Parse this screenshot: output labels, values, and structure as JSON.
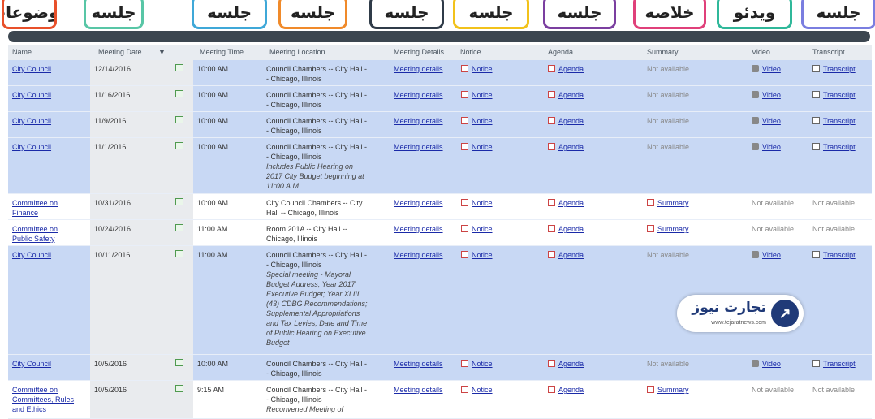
{
  "callouts": [
    {
      "label": "موضوعات",
      "border": "#e8502a",
      "pointer": "#e8502a"
    },
    {
      "label": "جلسه",
      "border": "#58c6a6",
      "pointer": "#58c6a6"
    },
    {
      "label": "جلسه",
      "border": "#3fa8d8",
      "pointer": "#3fa8d8"
    },
    {
      "label": "جلسه",
      "border": "#f08a2a",
      "pointer": "#f08a2a"
    },
    {
      "label": "جلسه",
      "border": "#2f3b48",
      "pointer": "#2f3b48"
    },
    {
      "label": "جلسه",
      "border": "#f2c21b",
      "pointer": "#f2c21b"
    },
    {
      "label": "جلسه",
      "border": "#7b3fa0",
      "pointer": "#7b3fa0"
    },
    {
      "label": "خلاصه",
      "border": "#e0407a",
      "pointer": "#e0407a"
    },
    {
      "label": "ویدئو",
      "border": "#2fb89a",
      "pointer": "#2fb89a"
    },
    {
      "label": "جلسه",
      "border": "#7a7ee0",
      "pointer": "#7a7ee0"
    }
  ],
  "columns": [
    "Name",
    "Meeting Date",
    "Meeting Time",
    "Meeting Location",
    "Meeting Details",
    "Notice",
    "Agenda",
    "Summary",
    "Video",
    "Transcript"
  ],
  "sort_indicator": "▼",
  "rows": [
    {
      "name": "City Council",
      "date": "12/14/2016",
      "time": "10:00 AM",
      "location": "Council Chambers -- City Hall -\n- Chicago, Illinois",
      "note": "",
      "details": "Meeting details",
      "notice": "Notice",
      "agenda": "Agenda",
      "summary": "Not available",
      "video": "Video",
      "transcript": "Transcript"
    },
    {
      "name": "City Council",
      "date": "11/16/2016",
      "time": "10:00 AM",
      "location": "Council Chambers -- City Hall -\n- Chicago, Illinois",
      "note": "",
      "details": "Meeting details",
      "notice": "Notice",
      "agenda": "Agenda",
      "summary": "Not available",
      "video": "Video",
      "transcript": "Transcript"
    },
    {
      "name": "City Council",
      "date": "11/9/2016",
      "time": "10:00 AM",
      "location": "Council Chambers -- City Hall -\n- Chicago, Illinois",
      "note": "",
      "details": "Meeting details",
      "notice": "Notice",
      "agenda": "Agenda",
      "summary": "Not available",
      "video": "Video",
      "transcript": "Transcript"
    },
    {
      "name": "City Council",
      "date": "11/1/2016",
      "time": "10:00 AM",
      "location": "Council Chambers -- City Hall -\n- Chicago, Illinois",
      "note": "Includes Public Hearing on\n2017 City Budget beginning at\n11:00 A.M.",
      "details": "Meeting details",
      "notice": "Notice",
      "agenda": "Agenda",
      "summary": "Not available",
      "video": "Video",
      "transcript": "Transcript"
    },
    {
      "name": "Committee on\nFinance",
      "date": "10/31/2016",
      "time": "10:00 AM",
      "location": "City Council Chambers -- City\nHall -- Chicago, Illinois",
      "note": "",
      "details": "Meeting details",
      "notice": "Notice",
      "agenda": "Agenda",
      "summary": "Summary",
      "video": "Not available",
      "transcript": "Not available"
    },
    {
      "name": "Committee on\nPublic Safety",
      "date": "10/24/2016",
      "time": "11:00 AM",
      "location": "Room 201A -- City Hall --\nChicago, Illinois",
      "note": "",
      "details": "Meeting details",
      "notice": "Notice",
      "agenda": "Agenda",
      "summary": "Summary",
      "video": "Not available",
      "transcript": "Not available"
    },
    {
      "name": "City Council",
      "date": "10/11/2016",
      "time": "11:00 AM",
      "location": "Council Chambers -- City Hall -\n- Chicago, Illinois",
      "note": "Special meeting - Mayoral\nBudget Address; Year 2017\nExecutive Budget; Year XLIII\n(43) CDBG Recommendations;\nSupplemental Appropriations\nand Tax Levies; Date and Time\nof Public Hearing on Executive\nBudget",
      "details": "Meeting details",
      "notice": "Notice",
      "agenda": "Agenda",
      "summary": "Not available",
      "video": "Video",
      "transcript": "Transcript"
    },
    {
      "name": "City Council",
      "date": "10/5/2016",
      "time": "10:00 AM",
      "location": "Council Chambers -- City Hall -\n- Chicago, Illinois",
      "note": "",
      "details": "Meeting details",
      "notice": "Notice",
      "agenda": "Agenda",
      "summary": "Not available",
      "video": "Video",
      "transcript": "Transcript"
    },
    {
      "name": "Committee on\nCommittees, Rules\nand Ethics",
      "date": "10/5/2016",
      "time": "9:15 AM",
      "location": "Council Chambers -- City Hall -\n- Chicago, Illinois",
      "note": "Reconvened Meeting of",
      "details": "Meeting details",
      "notice": "Notice",
      "agenda": "Agenda",
      "summary": "Summary",
      "video": "Not available",
      "transcript": "Not available"
    }
  ],
  "logo": {
    "name": "تجارت نیوز",
    "url": "www.tejaratnews.com"
  }
}
